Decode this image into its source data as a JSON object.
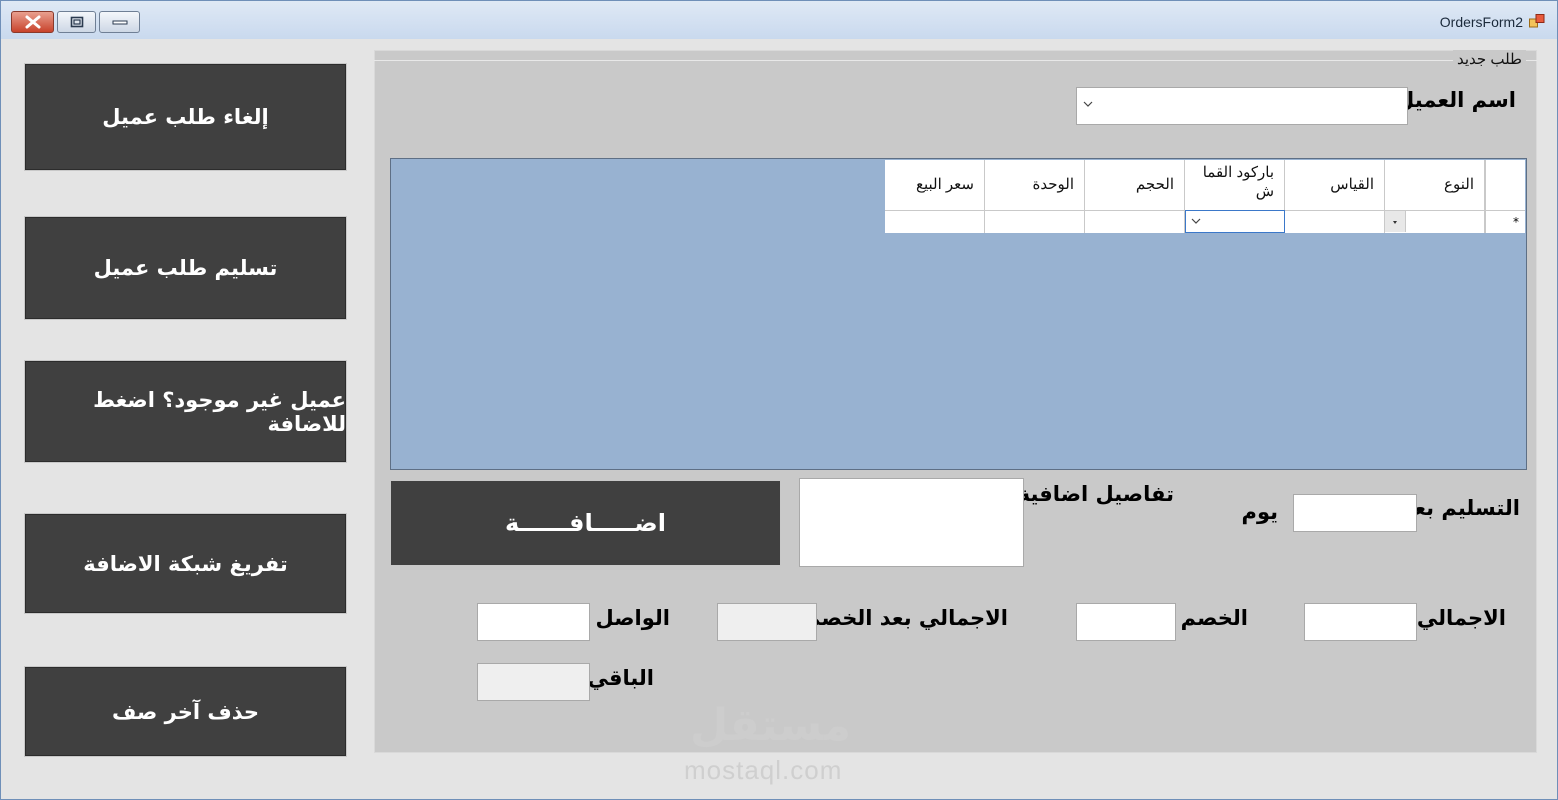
{
  "window": {
    "title": "OrdersForm2"
  },
  "side_buttons": {
    "cancel": "إلغاء طلب عميل",
    "deliver": "تسليم طلب عميل",
    "new_customer": "عميل غير موجود؟ اضغط للاضافة",
    "clear_grid": "تفريغ شبكة الاضافة",
    "delete_last": "حذف آخر صف"
  },
  "form": {
    "group_title": "طلب جديد",
    "customer_name_label": "اسم العميل",
    "customer_name_value": "",
    "grid": {
      "columns": [
        "النوع",
        "القياس",
        "باركود القماش",
        "الحجم",
        "الوحدة",
        "سعر البيع"
      ],
      "new_row_marker": "*"
    },
    "delivery_label": "التسليم بعد",
    "delivery_unit": "يوم",
    "extra_details_label": "تفاصيل اضافية",
    "add_button": "اضـــــافــــــة",
    "total_label": "الاجمالي",
    "discount_label": "الخصم",
    "total_after_discount_label": "الاجمالي بعد الخصم",
    "paid_label": "الواصل",
    "remaining_label": "الباقي"
  },
  "watermark": {
    "text": "mostaql.com",
    "arabic": "مستقل"
  }
}
